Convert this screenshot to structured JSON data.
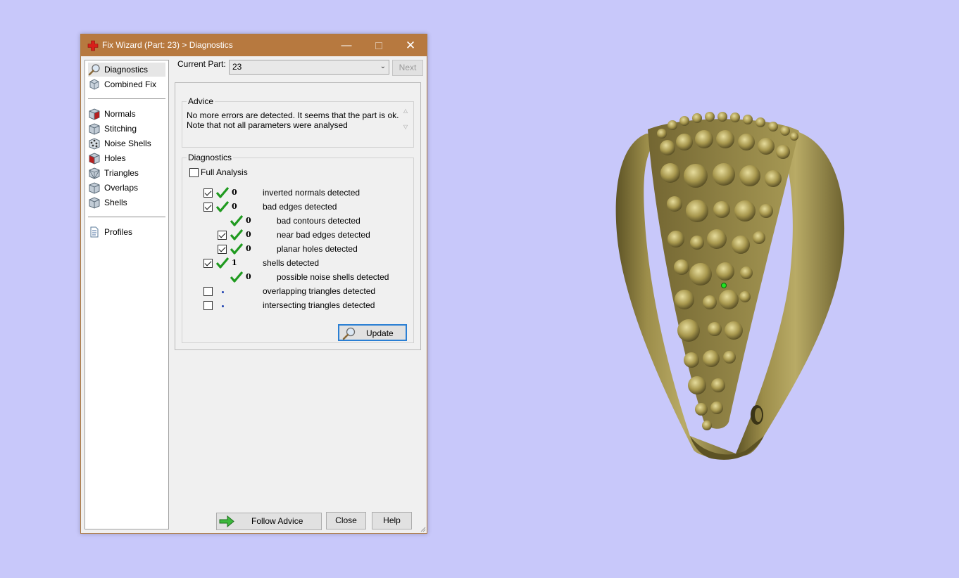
{
  "window": {
    "title": "Fix Wizard (Part: 23) > Diagnostics",
    "minimize_glyph": "—",
    "close_glyph": "✕"
  },
  "nav": {
    "items": [
      {
        "label": "Diagnostics",
        "icon": "magnifier-icon",
        "selected": true
      },
      {
        "label": "Combined Fix",
        "icon": "combined-fix-icon"
      },
      {
        "label": "Normals",
        "icon": "normals-cube-icon"
      },
      {
        "label": "Stitching",
        "icon": "stitching-cube-icon"
      },
      {
        "label": "Noise Shells",
        "icon": "noise-shells-icon"
      },
      {
        "label": "Holes",
        "icon": "holes-cube-icon"
      },
      {
        "label": "Triangles",
        "icon": "triangles-cube-icon"
      },
      {
        "label": "Overlaps",
        "icon": "overlaps-cube-icon"
      },
      {
        "label": "Shells",
        "icon": "shells-cube-icon"
      },
      {
        "label": "Profiles",
        "icon": "profiles-document-icon"
      }
    ]
  },
  "current_part": {
    "label": "Current Part:",
    "value": "23",
    "next_label": "Next"
  },
  "advice": {
    "title": "Advice",
    "line1": "No more errors are detected. It seems that the part is ok.",
    "line2": "Note that not all parameters were analysed"
  },
  "diagnostics": {
    "title": "Diagnostics",
    "full_analysis_label": "Full Analysis",
    "full_analysis_checked": false,
    "rows": [
      {
        "checkbox": true,
        "checked": true,
        "status": "ok",
        "count": "0",
        "label": "inverted normals detected",
        "indent": 0
      },
      {
        "checkbox": true,
        "checked": true,
        "status": "ok",
        "count": "0",
        "label": "bad edges detected",
        "indent": 0
      },
      {
        "checkbox": false,
        "checked": false,
        "status": "ok",
        "count": "0",
        "label": "bad contours detected",
        "indent": 1
      },
      {
        "checkbox": true,
        "checked": true,
        "status": "ok",
        "count": "0",
        "label": "near bad edges detected",
        "indent": 1
      },
      {
        "checkbox": true,
        "checked": true,
        "status": "ok",
        "count": "0",
        "label": "planar holes detected",
        "indent": 1
      },
      {
        "checkbox": true,
        "checked": true,
        "status": "ok",
        "count": "1",
        "label": "shells detected",
        "indent": 0
      },
      {
        "checkbox": false,
        "checked": false,
        "status": "ok",
        "count": "0",
        "label": "possible noise shells detected",
        "indent": 1
      },
      {
        "checkbox": true,
        "checked": false,
        "status": "unknown",
        "count": "",
        "label": "overlapping triangles detected",
        "indent": 0
      },
      {
        "checkbox": true,
        "checked": false,
        "status": "unknown",
        "count": "",
        "label": "intersecting triangles detected",
        "indent": 0
      }
    ],
    "update_label": "Update"
  },
  "footer": {
    "follow_advice_label": "Follow Advice",
    "close_label": "Close",
    "help_label": "Help"
  },
  "colors": {
    "titlebar": "#b7793f",
    "desktop": "#c8c8fa",
    "check_green": "#1f9a1f",
    "ring_gold": "#8a7a3a"
  }
}
